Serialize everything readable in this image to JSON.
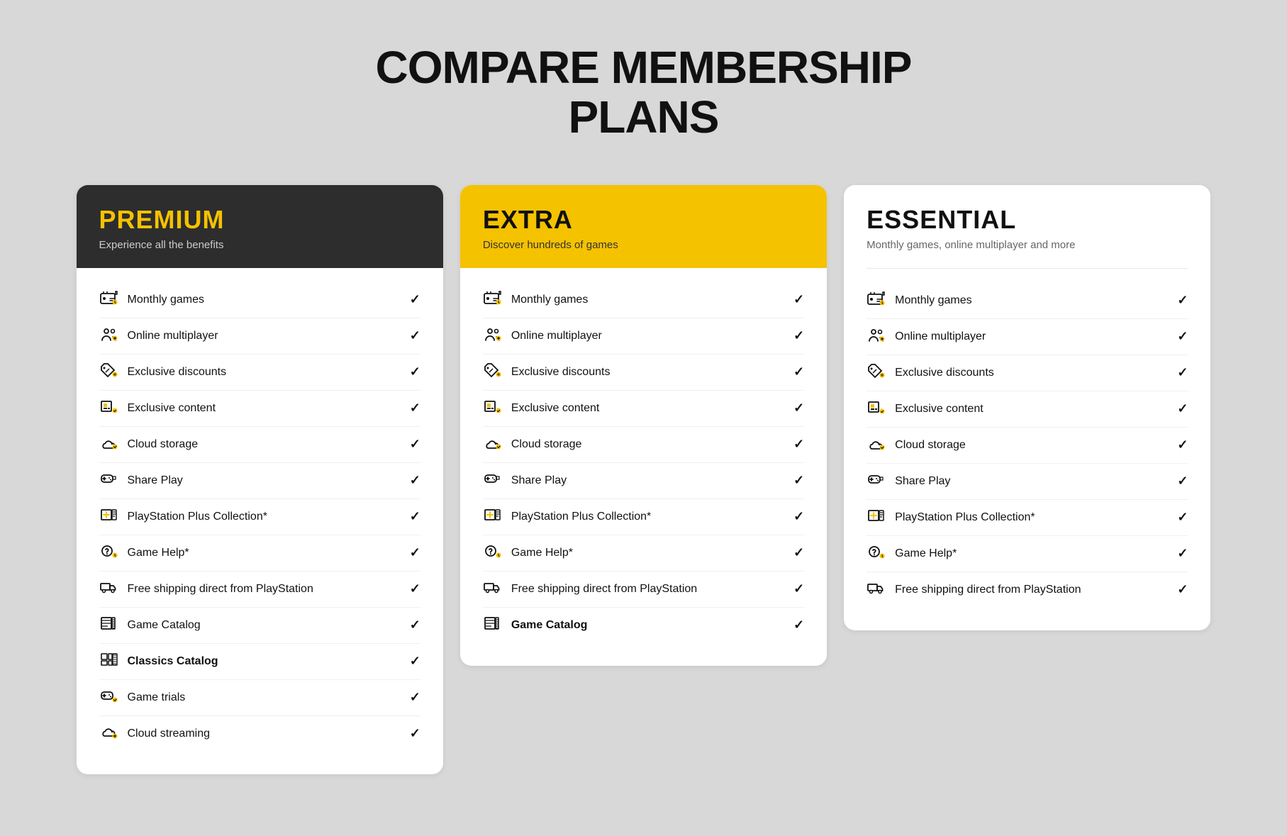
{
  "page": {
    "title_line1": "COMPARE MEMBERSHIP",
    "title_line2": "PLANS"
  },
  "plans": [
    {
      "id": "premium",
      "header_class": "premium",
      "name": "PREMIUM",
      "tagline": "Experience all the benefits",
      "features": [
        {
          "icon": "🎁",
          "label": "Monthly games",
          "bold": false
        },
        {
          "icon": "👥",
          "label": "Online multiplayer",
          "bold": false
        },
        {
          "icon": "🏷️",
          "label": "Exclusive discounts",
          "bold": false
        },
        {
          "icon": "⚙️",
          "label": "Exclusive content",
          "bold": false
        },
        {
          "icon": "☁️",
          "label": "Cloud storage",
          "bold": false
        },
        {
          "icon": "🎮",
          "label": "Share Play",
          "bold": false
        },
        {
          "icon": "🖥️",
          "label": "PlayStation Plus Collection*",
          "bold": false
        },
        {
          "icon": "💡",
          "label": "Game Help*",
          "bold": false
        },
        {
          "icon": "🚚",
          "label": "Free shipping direct from PlayStation",
          "bold": false
        },
        {
          "icon": "📋",
          "label": "Game Catalog",
          "bold": false
        },
        {
          "icon": "📦",
          "label": "Classics Catalog",
          "bold": true
        },
        {
          "icon": "🎮",
          "label": "Game trials",
          "bold": false
        },
        {
          "icon": "☁️",
          "label": "Cloud streaming",
          "bold": false
        }
      ]
    },
    {
      "id": "extra",
      "header_class": "extra",
      "name": "EXTRA",
      "tagline": "Discover hundreds of games",
      "features": [
        {
          "icon": "🎁",
          "label": "Monthly games",
          "bold": false
        },
        {
          "icon": "👥",
          "label": "Online multiplayer",
          "bold": false
        },
        {
          "icon": "🏷️",
          "label": "Exclusive discounts",
          "bold": false
        },
        {
          "icon": "⚙️",
          "label": "Exclusive content",
          "bold": false
        },
        {
          "icon": "☁️",
          "label": "Cloud storage",
          "bold": false
        },
        {
          "icon": "🎮",
          "label": "Share Play",
          "bold": false
        },
        {
          "icon": "🖥️",
          "label": "PlayStation Plus Collection*",
          "bold": false
        },
        {
          "icon": "💡",
          "label": "Game Help*",
          "bold": false
        },
        {
          "icon": "🚚",
          "label": "Free shipping direct from PlayStation",
          "bold": false
        },
        {
          "icon": "📋",
          "label": "Game Catalog",
          "bold": true
        }
      ]
    },
    {
      "id": "essential",
      "header_class": "essential",
      "name": "ESSENTIAL",
      "tagline": "Monthly games, online multiplayer and more",
      "features": [
        {
          "icon": "🎁",
          "label": "Monthly games",
          "bold": false
        },
        {
          "icon": "👥",
          "label": "Online multiplayer",
          "bold": false
        },
        {
          "icon": "🏷️",
          "label": "Exclusive discounts",
          "bold": false
        },
        {
          "icon": "⚙️",
          "label": "Exclusive content",
          "bold": false
        },
        {
          "icon": "☁️",
          "label": "Cloud storage",
          "bold": false
        },
        {
          "icon": "🎮",
          "label": "Share Play",
          "bold": false
        },
        {
          "icon": "🖥️",
          "label": "PlayStation Plus Collection*",
          "bold": false
        },
        {
          "icon": "💡",
          "label": "Game Help*",
          "bold": false
        },
        {
          "icon": "🚚",
          "label": "Free shipping direct from PlayStation",
          "bold": false
        }
      ]
    }
  ],
  "icons": {
    "monthly_games": "🎁",
    "online_multiplayer": "👤",
    "exclusive_discounts": "🏷️",
    "exclusive_content": "⚙️",
    "cloud_storage": "☁️",
    "share_play": "🎮",
    "ps_plus_collection": "🖥️",
    "game_help": "💡",
    "free_shipping": "🚚",
    "game_catalog": "📋",
    "classics_catalog": "📦",
    "game_trials": "🎮",
    "cloud_streaming": "☁️"
  }
}
